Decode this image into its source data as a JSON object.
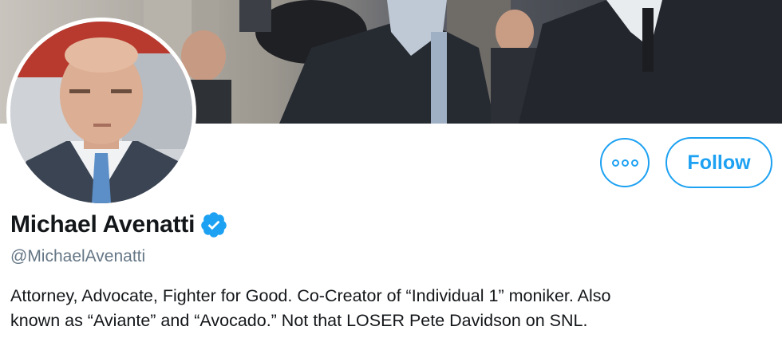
{
  "profile": {
    "display_name": "Michael Avenatti",
    "handle": "@MichaelAvenatti",
    "verified": true,
    "bio_lines": [
      "Attorney, Advocate, Fighter for Good. Co-Creator of “Individual 1” moniker. Also",
      "known as “Aviante” and “Avocado.” Not that LOSER Pete Davidson on SNL."
    ]
  },
  "actions": {
    "follow_label": "Follow",
    "more_icon": "more-options-icon"
  },
  "colors": {
    "accent": "#1da1f2",
    "text": "#14171a",
    "muted": "#657786"
  }
}
